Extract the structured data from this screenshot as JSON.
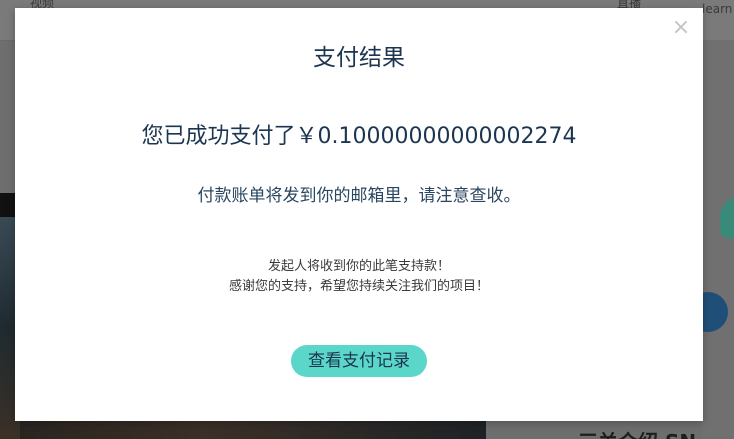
{
  "background": {
    "nav_left": "视频",
    "nav_mid": "直播",
    "nav_right": "learn",
    "bottom_text": "三关介绍 SN"
  },
  "modal": {
    "title": "支付结果",
    "close_label": "×",
    "success_text": "您已成功支付了￥0.10000000000002274",
    "bill_text": "付款账单将发到你的邮箱里，请注意查收。",
    "thanks_line1": "发起人将收到你的此笔支持款！",
    "thanks_line2": "感谢您的支持，希望您持续关注我们的项目！",
    "records_button": "查看支付记录"
  },
  "colors": {
    "accent": "#5ad7c9",
    "title_text": "#1c3550",
    "overlay": "#6e6e6e"
  }
}
